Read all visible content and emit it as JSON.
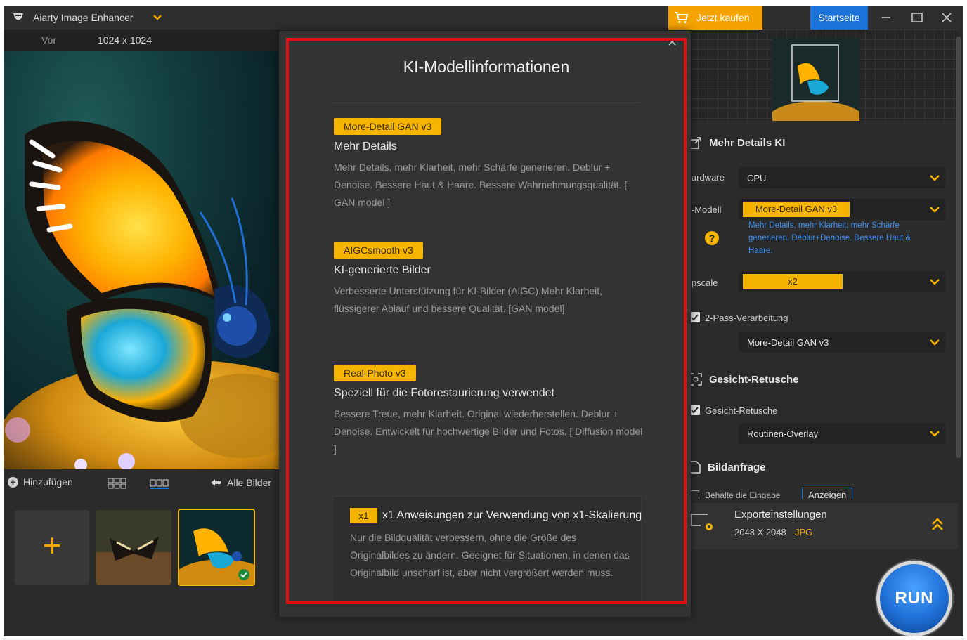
{
  "titlebar": {
    "app_title": "Aiarty Image Enhancer",
    "buy_label": "Jetzt kaufen",
    "home_label": "Startseite",
    "brand_color": "#f5a300",
    "home_color": "#1b72d8"
  },
  "view_bar": {
    "before_label": "Vor",
    "resolution": "1024 x 1024"
  },
  "bottom_bar": {
    "add_label": "Hinzufügen",
    "all_images_label": "Alle Bilder"
  },
  "right_panel": {
    "section1_title": "Mehr Details KI",
    "hardware_label": "lardware",
    "hardware_value": "CPU",
    "model_label": "l-Modell",
    "model_value": "More-Detail GAN  v3",
    "model_desc": "Mehr Details, mehr Klarheit, mehr Schärfe generieren. Deblur+Denoise. Bessere Haut & Haare.",
    "upscale_label": "lpscale",
    "upscale_value": "x2",
    "two_pass_label": "2-Pass-Verarbeitung",
    "two_pass_value": "More-Detail GAN  v3",
    "section2_title": "Gesicht-Retusche",
    "face_label": "Gesicht-Retusche",
    "face_value": "Routinen-Overlay",
    "section3_title": "Bildanfrage",
    "keep_input_label": "Behalte die Eingabe",
    "show_label": "Anzeigen",
    "export_title": "Exporteinstellungen",
    "export_size": "2048 X 2048",
    "export_format": "JPG",
    "run_label": "RUN"
  },
  "modal": {
    "title": "KI-Modellinformationen",
    "models": [
      {
        "tag": "More-Detail GAN v3",
        "subtitle": "Mehr Details",
        "desc": "Mehr Details, mehr Klarheit, mehr Schärfe generieren. Deblur + Denoise. Bessere Haut & Haare. Bessere Wahrnehmungsqualität.  [ GAN model ]"
      },
      {
        "tag": "AIGCsmooth v3",
        "subtitle": "KI-generierte Bilder",
        "desc": "Verbesserte Unterstützung für KI-Bilder (AIGC).Mehr Klarheit, flüssigerer Ablauf und bessere Qualität. [GAN model]"
      },
      {
        "tag": "Real-Photo v3",
        "subtitle": "Speziell für die Fotorestaurierung verwendet",
        "desc": "Bessere Treue, mehr Klarheit. Original wiederherstellen. Deblur + Denoise. Entwickelt für hochwertige Bilder und Fotos. [ Diffusion model ]"
      }
    ],
    "x1": {
      "tag": "x1",
      "title": "x1 Anweisungen zur Verwendung von x1-Skalierung",
      "desc": "Nur die Bildqualität verbessern, ohne die Größe des Originalbildes zu ändern. Geeignet für Situationen, in denen das Originalbild unscharf ist, aber nicht vergrößert werden muss."
    }
  }
}
